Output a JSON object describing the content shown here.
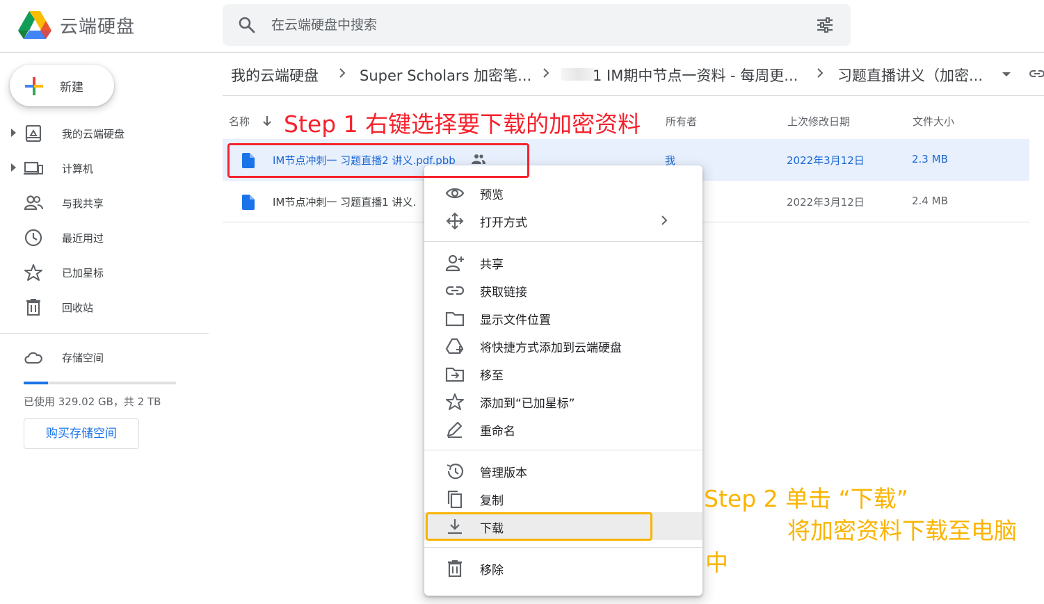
{
  "app": {
    "title": "云端硬盘"
  },
  "search": {
    "placeholder": "在云端硬盘中搜索"
  },
  "sidebar": {
    "new_label": "新建",
    "items": [
      {
        "label": "我的云端硬盘",
        "icon": "drive-icon"
      },
      {
        "label": "计算机",
        "icon": "computer-icon"
      },
      {
        "label": "与我共享",
        "icon": "shared-people-icon"
      },
      {
        "label": "最近用过",
        "icon": "clock-icon"
      },
      {
        "label": "已加星标",
        "icon": "star-icon"
      },
      {
        "label": "回收站",
        "icon": "trash-icon"
      },
      {
        "label": "存储空间",
        "icon": "cloud-icon"
      }
    ],
    "storage_used_fraction": 0.16,
    "storage_text": "已使用 329.02 GB，共 2 TB",
    "buy_label": "购买存储空间"
  },
  "breadcrumb": {
    "items": [
      "我的云端硬盘",
      "Super Scholars 加密笔...",
      "1 IM期中节点一资料 - 每周更...",
      "习题直播讲义（加密..."
    ]
  },
  "files": {
    "columns": {
      "name": "名称",
      "owner": "所有者",
      "modified": "上次修改日期",
      "size": "文件大小"
    },
    "rows": [
      {
        "name": "IM节点冲刺一 习题直播2 讲义.pdf.pbb",
        "owner": "我",
        "modified": "2022年3月12日",
        "size": "2.3 MB",
        "selected": true
      },
      {
        "name": "IM节点冲刺一 习题直播1 讲义.",
        "owner": "",
        "modified": "2022年3月12日",
        "size": "2.4 MB",
        "selected": false
      }
    ]
  },
  "context_menu": {
    "preview": "预览",
    "open_with": "打开方式",
    "share": "共享",
    "get_link": "获取链接",
    "show_location": "显示文件位置",
    "add_shortcut": "将快捷方式添加到云端硬盘",
    "move_to": "移至",
    "add_star": "添加到“已加星标”",
    "rename": "重命名",
    "manage_versions": "管理版本",
    "copy": "复制",
    "download": "下载",
    "remove": "移除"
  },
  "annotations": {
    "step1": "Step 1 右键选择要下载的加密资料",
    "step2_line1": "Step 2 单击 “下载”",
    "step2_line2": "将加密资料下载至电脑",
    "step2_line3": "中"
  },
  "colors": {
    "accent": "#1a73e8",
    "selected_row": "#e8f0fe",
    "annotation_red": "#f5222d",
    "annotation_yellow": "#fab400"
  }
}
